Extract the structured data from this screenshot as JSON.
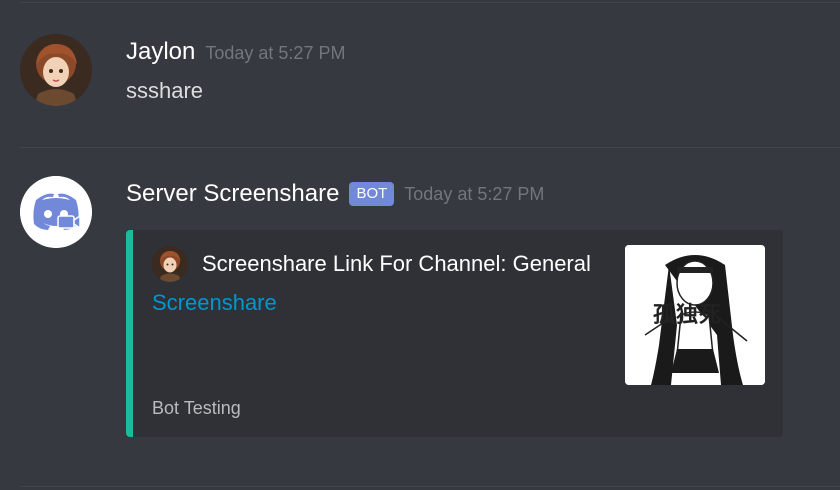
{
  "messages": [
    {
      "username": "Jaylon",
      "timestamp": "Today at 5:27 PM",
      "content": "ssshare",
      "avatar_icon": "anime-girl-avatar"
    },
    {
      "username": "Server Screenshare",
      "bot_tag": "BOT",
      "timestamp": "Today at 5:27 PM",
      "avatar_icon": "discord-logo-icon",
      "embed": {
        "author_name": "Screenshare Link For Channel: General",
        "link_text": "Screenshare",
        "footer": "Bot Testing",
        "thumbnail_text": "孤独死",
        "accent_color": "#1abc9c"
      }
    }
  ],
  "colors": {
    "background": "#36393f",
    "embed_background": "#2f3136",
    "bot_tag": "#7289da",
    "link": "#0096cf",
    "timestamp": "#72767d"
  }
}
